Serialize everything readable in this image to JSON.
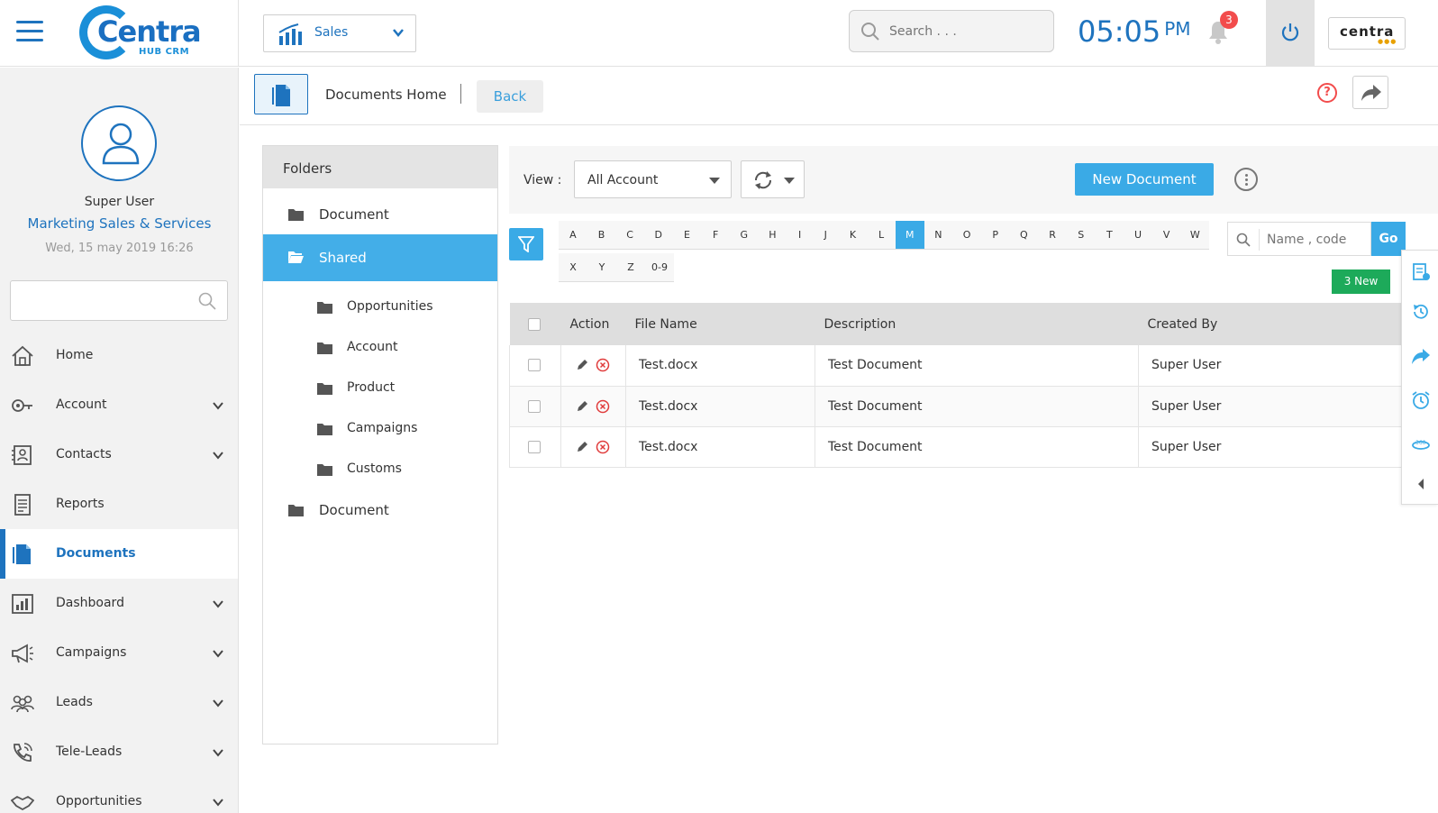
{
  "app": {
    "logo_text": "Centra",
    "logo_sub": "HUB CRM",
    "module": "Sales",
    "search_placeholder": "Search . . .",
    "clock_time": "05:05",
    "clock_ampm": "PM",
    "notification_count": "3",
    "partner_logo": "centra",
    "accent_color": "#1e73be",
    "button_color": "#3aaae6"
  },
  "user": {
    "name": "Super User",
    "role": "Marketing Sales & Services",
    "datetime": "Wed, 15 may 2019 16:26"
  },
  "sidebar": {
    "items": [
      {
        "label": "Home",
        "icon": "home-icon",
        "chevron": false
      },
      {
        "label": "Account",
        "icon": "key-icon",
        "chevron": true
      },
      {
        "label": "Contacts",
        "icon": "contacts-icon",
        "chevron": true
      },
      {
        "label": "Reports",
        "icon": "reports-icon",
        "chevron": false
      },
      {
        "label": "Documents",
        "icon": "document-icon",
        "chevron": false,
        "active": true
      },
      {
        "label": "Dashboard",
        "icon": "dashboard-icon",
        "chevron": true
      },
      {
        "label": "Campaigns",
        "icon": "megaphone-icon",
        "chevron": true
      },
      {
        "label": "Leads",
        "icon": "people-icon",
        "chevron": true
      },
      {
        "label": "Tele-Leads",
        "icon": "phone-icon",
        "chevron": true
      },
      {
        "label": "Opportunities",
        "icon": "handshake-icon",
        "chevron": true
      }
    ]
  },
  "subheader": {
    "title": "Documents Home",
    "back_label": "Back",
    "help_glyph": "?"
  },
  "folders": {
    "title": "Folders",
    "items": [
      {
        "label": "Document",
        "level": 0
      },
      {
        "label": "Shared",
        "level": 0,
        "active": true
      },
      {
        "label": "Opportunities",
        "level": 1
      },
      {
        "label": "Account",
        "level": 1
      },
      {
        "label": "Product",
        "level": 1
      },
      {
        "label": "Campaigns",
        "level": 1
      },
      {
        "label": "Customs",
        "level": 1
      },
      {
        "label": "Document",
        "level": 0
      }
    ]
  },
  "toolbar": {
    "view_label": "View :",
    "view_value": "All Account",
    "new_document_label": "New Document"
  },
  "alpha_filter": {
    "row1": [
      "A",
      "B",
      "C",
      "D",
      "E",
      "F",
      "G",
      "H",
      "I",
      "J",
      "K",
      "L",
      "M",
      "N",
      "O",
      "P",
      "Q",
      "R",
      "S",
      "T",
      "U",
      "V",
      "W"
    ],
    "row2": [
      "X",
      "Y",
      "Z",
      "0-9"
    ],
    "active": "M",
    "search_placeholder": "Name , code",
    "go_label": "Go",
    "new_badge": "3 New"
  },
  "table": {
    "columns": [
      "Action",
      "File Name",
      "Description",
      "Created By"
    ],
    "rows": [
      {
        "file_name": "Test.docx",
        "description": "Test Document",
        "created_by": "Super User"
      },
      {
        "file_name": "Test.docx",
        "description": "Test Document",
        "created_by": "Super User"
      },
      {
        "file_name": "Test.docx",
        "description": "Test Document",
        "created_by": "Super User"
      }
    ]
  },
  "quick_panel": {
    "icons": [
      "clipboard-check-icon",
      "history-icon",
      "share-arrow-icon",
      "alarm-clock-icon",
      "view-360-icon",
      "collapse-left-icon"
    ]
  }
}
